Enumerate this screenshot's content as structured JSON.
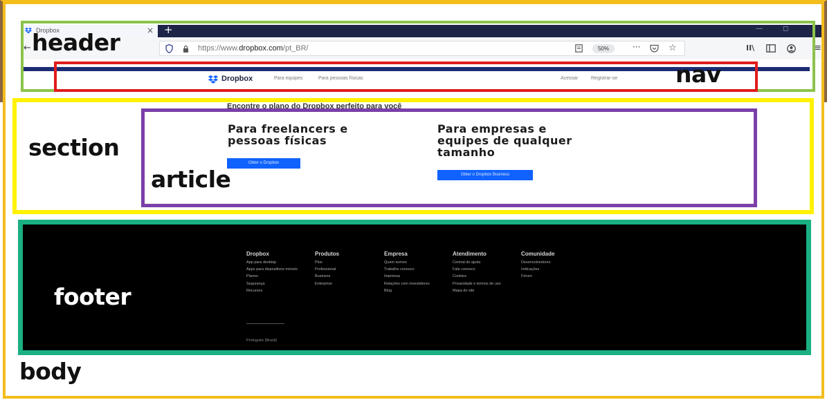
{
  "colors": {
    "body_frame": "#f3bd1b",
    "header_zone_side": "#8b6540",
    "header_frame": "#8bc34a",
    "nav_frame": "#e01c1c",
    "section_frame": "#fff200",
    "article_frame": "#7a3fa8",
    "footer_frame": "#1ab082",
    "dropbox_blue": "#0f62fe",
    "browser_dark": "#1d2448"
  },
  "labels": {
    "header": "header",
    "nav": "nav",
    "section": "section",
    "article": "article",
    "footer": "footer",
    "body": "body"
  },
  "browser": {
    "tab_title": "Dropbox",
    "tab_close": "×",
    "new_tab": "+",
    "url_prefix": "https://www.",
    "url_host": "dropbox.com",
    "url_path": "/pt_BR/",
    "zoom": "50%",
    "icons": [
      "back-arrow-icon",
      "shield-icon",
      "lock-icon",
      "reader-icon",
      "more-icon",
      "pocket-icon",
      "star-icon",
      "library-icon",
      "sidebar-icon",
      "account-icon",
      "menu-icon"
    ]
  },
  "site_nav": {
    "brand": "Dropbox",
    "links": [
      "Para equipes",
      "Para pessoas físicas"
    ],
    "right_links": [
      "Acessar",
      "Registrar-se"
    ]
  },
  "section": {
    "heading": "Encontre o plano do Dropbox perfeito para você",
    "plans": [
      {
        "title_line1": "Para freelancers e",
        "title_line2": "pessoas físicas",
        "title_line3": "",
        "button": "Obter o Dropbox"
      },
      {
        "title_line1": "Para empresas e",
        "title_line2": "equipes de qualquer",
        "title_line3": "tamanho",
        "button": "Obter o Dropbox Business"
      }
    ]
  },
  "footer": {
    "columns": [
      {
        "title": "Dropbox",
        "links": [
          "App para desktop",
          "Apps para dispositivos móveis",
          "Planos",
          "Segurança",
          "Recursos"
        ]
      },
      {
        "title": "Produtos",
        "links": [
          "Plus",
          "Professional",
          "Business",
          "Enterprise"
        ]
      },
      {
        "title": "Empresa",
        "links": [
          "Quem somos",
          "Trabalhe conosco",
          "Imprensa",
          "Relações com investidores",
          "Blog"
        ]
      },
      {
        "title": "Atendimento",
        "links": [
          "Central de ajuda",
          "Fale conosco",
          "Cookies",
          "Privacidade e termos de uso",
          "Mapa do site"
        ]
      },
      {
        "title": "Comunidade",
        "links": [
          "Desenvolvedores",
          "Indicações",
          "Fórum"
        ]
      }
    ],
    "language": "Português (Brasil)"
  }
}
